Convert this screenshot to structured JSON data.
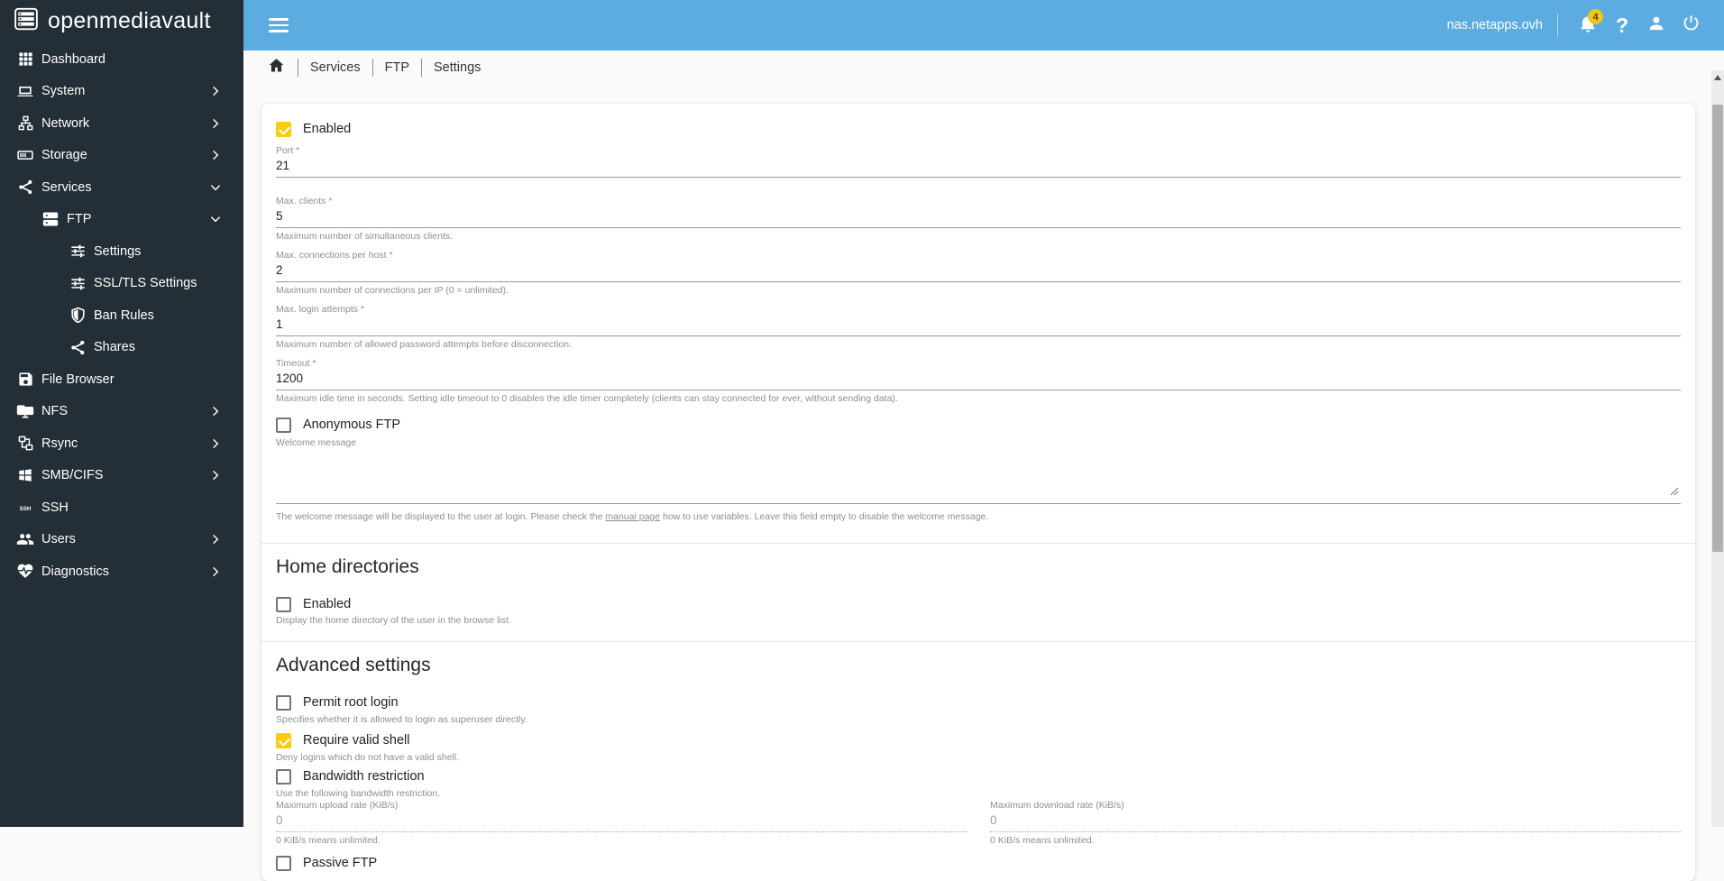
{
  "colors": {
    "topbar_blue": "#5CACE2",
    "sidebar_dark": "#232E37",
    "accent_yellow": "#FACD14",
    "badge_yellow": "#F0C419"
  },
  "brand": {
    "name": "openmediavault"
  },
  "topbar": {
    "hostname": "nas.netapps.ovh",
    "notification_count": "4",
    "help_glyph": "?"
  },
  "breadcrumb": {
    "items": [
      "Services",
      "FTP",
      "Settings"
    ]
  },
  "sidebar": {
    "items": [
      {
        "label": "Dashboard",
        "icon": "dashboard-grid-icon"
      },
      {
        "label": "System",
        "icon": "laptop-icon"
      },
      {
        "label": "Network",
        "icon": "lan-icon"
      },
      {
        "label": "Storage",
        "icon": "storage-icon"
      },
      {
        "label": "Services",
        "icon": "share-icon"
      },
      {
        "label": "FTP",
        "icon": "server-icon"
      },
      {
        "label": "Settings",
        "icon": "tune-icon"
      },
      {
        "label": "SSL/TLS Settings",
        "icon": "tune-icon"
      },
      {
        "label": "Ban Rules",
        "icon": "shield-icon"
      },
      {
        "label": "Shares",
        "icon": "share-icon"
      },
      {
        "label": "File Browser",
        "icon": "save-icon"
      },
      {
        "label": "NFS",
        "icon": "folder-network-icon"
      },
      {
        "label": "Rsync",
        "icon": "sync-nodes-icon"
      },
      {
        "label": "SMB/CIFS",
        "icon": "windows-icon"
      },
      {
        "label": "SSH",
        "icon": "ssh-text-icon"
      },
      {
        "label": "Users",
        "icon": "users-icon"
      },
      {
        "label": "Diagnostics",
        "icon": "heart-pulse-icon"
      }
    ]
  },
  "form": {
    "enabled": {
      "label": "Enabled",
      "checked": "true"
    },
    "port": {
      "label": "Port *",
      "value": "21"
    },
    "max_clients": {
      "label": "Max. clients *",
      "value": "5",
      "hint": "Maximum number of simultaneous clients."
    },
    "max_connections": {
      "label": "Max. connections per host *",
      "value": "2",
      "hint": "Maximum number of connections per IP (0 = unlimited)."
    },
    "max_login_attempts": {
      "label": "Max. login attempts *",
      "value": "1",
      "hint": "Maximum number of allowed password attempts before disconnection."
    },
    "timeout": {
      "label": "Timeout *",
      "value": "1200",
      "hint": "Maximum idle time in seconds. Setting idle timeout to 0 disables the idle timer completely (clients can stay connected for ever, without sending data)."
    },
    "anonymous_ftp": {
      "label": "Anonymous FTP",
      "checked": "false"
    },
    "welcome_message": {
      "label": "Welcome message",
      "value": "",
      "hint_prefix": "The welcome message will be displayed to the user at login. Please check the ",
      "link_text": "manual page",
      "hint_suffix": " how to use variables. Leave this field empty to disable the welcome message."
    },
    "home_directories": {
      "heading": "Home directories",
      "enabled": {
        "label": "Enabled",
        "checked": "false"
      },
      "hint": "Display the home directory of the user in the browse list."
    },
    "advanced": {
      "heading": "Advanced settings",
      "permit_root_login": {
        "label": "Permit root login",
        "checked": "false",
        "hint": "Specifies whether it is allowed to login as superuser directly."
      },
      "require_valid_shell": {
        "label": "Require valid shell",
        "checked": "true",
        "hint": "Deny logins which do not have a valid shell."
      },
      "bandwidth_restriction": {
        "label": "Bandwidth restriction",
        "checked": "false",
        "hint": "Use the following bandwidth restriction."
      },
      "max_upload_rate": {
        "label": "Maximum upload rate (KiB/s)",
        "value": "0",
        "hint": "0 KiB/s means unlimited."
      },
      "max_download_rate": {
        "label": "Maximum download rate (KiB/s)",
        "value": "0",
        "hint": "0 KiB/s means unlimited."
      },
      "passive_ftp": {
        "label": "Passive FTP",
        "checked": "false"
      }
    }
  }
}
